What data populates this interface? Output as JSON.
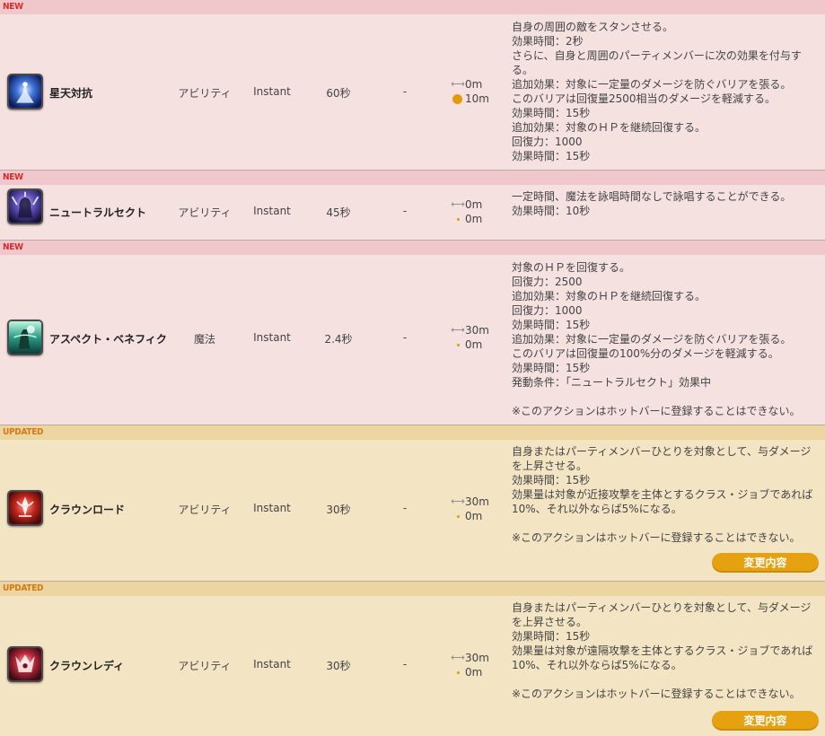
{
  "tags": {
    "new": "NEW",
    "updated": "UPDATED"
  },
  "colors": {
    "new_bg": "#f6e1e1",
    "new_tag": "#d32b2b",
    "updated_bg": "#f3e4c4",
    "updated_tag": "#d17a14",
    "accent": "#e5a110"
  },
  "actions": [
    {
      "tag": "NEW",
      "icon": "star-collision-icon",
      "name": "星天対抗",
      "type": "アビリティ",
      "cast": "Instant",
      "recast": "60秒",
      "cost": "-",
      "range": "0m",
      "radius": "10m",
      "description": [
        "自身の周囲の敵をスタンさせる。",
        "効果時間：2秒",
        "さらに、自身と周囲のパーティメンバーに次の効果を付与す",
        "る。",
        "追加効果：対象に一定量のダメージを防ぐバリアを張る。",
        "このバリアは回復量2500相当のダメージを軽減する。",
        "効果時間：15秒",
        "追加効果：対象のＨＰを継続回復する。",
        "回復力：1000",
        "効果時間：15秒"
      ]
    },
    {
      "tag": "NEW",
      "icon": "neutral-sect-icon",
      "name": "ニュートラルセクト",
      "type": "アビリティ",
      "cast": "Instant",
      "recast": "45秒",
      "cost": "-",
      "range": "0m",
      "radius": "0m",
      "description": [
        "一定時間、魔法を詠唱時間なしで詠唱することができる。",
        "効果時間：10秒"
      ]
    },
    {
      "tag": "NEW",
      "icon": "aspected-benefic-icon",
      "name": "アスペクト・ベネフィク",
      "type": "魔法",
      "cast": "Instant",
      "recast": "2.4秒",
      "cost": "-",
      "range": "30m",
      "radius": "0m",
      "description": [
        "対象のＨＰを回復する。",
        "回復力：2500",
        "追加効果：対象のＨＰを継続回復する。",
        "回復力：1000",
        "効果時間：15秒",
        "追加効果：対象に一定量のダメージを防ぐバリアを張る。",
        "このバリアは回復量の100%分のダメージを軽減する。",
        "効果時間：15秒",
        "発動条件：「ニュートラルセクト」効果中",
        "",
        "※このアクションはホットバーに登録することはできない。"
      ]
    },
    {
      "tag": "UPDATED",
      "icon": "lord-of-crowns-icon",
      "name": "クラウンロード",
      "type": "アビリティ",
      "cast": "Instant",
      "recast": "30秒",
      "cost": "-",
      "range": "30m",
      "radius": "0m",
      "description": [
        "自身またはパーティメンバーひとりを対象として、与ダメージ",
        "を上昇させる。",
        "効果時間：15秒",
        "効果量は対象が近接攻撃を主体とするクラス・ジョブであれば",
        "10%、それ以外ならば5%になる。",
        "",
        "※このアクションはホットバーに登録することはできない。"
      ],
      "button": "変更内容"
    },
    {
      "tag": "UPDATED",
      "icon": "lady-of-crowns-icon",
      "name": "クラウンレディ",
      "type": "アビリティ",
      "cast": "Instant",
      "recast": "30秒",
      "cost": "-",
      "range": "30m",
      "radius": "0m",
      "description": [
        "自身またはパーティメンバーひとりを対象として、与ダメージ",
        "を上昇させる。",
        "効果時間：15秒",
        "効果量は対象が遠隔攻撃を主体とするクラス・ジョブであれば",
        "10%、それ以外ならば5%になる。",
        "",
        "※このアクションはホットバーに登録することはできない。"
      ],
      "button": "変更内容"
    }
  ]
}
